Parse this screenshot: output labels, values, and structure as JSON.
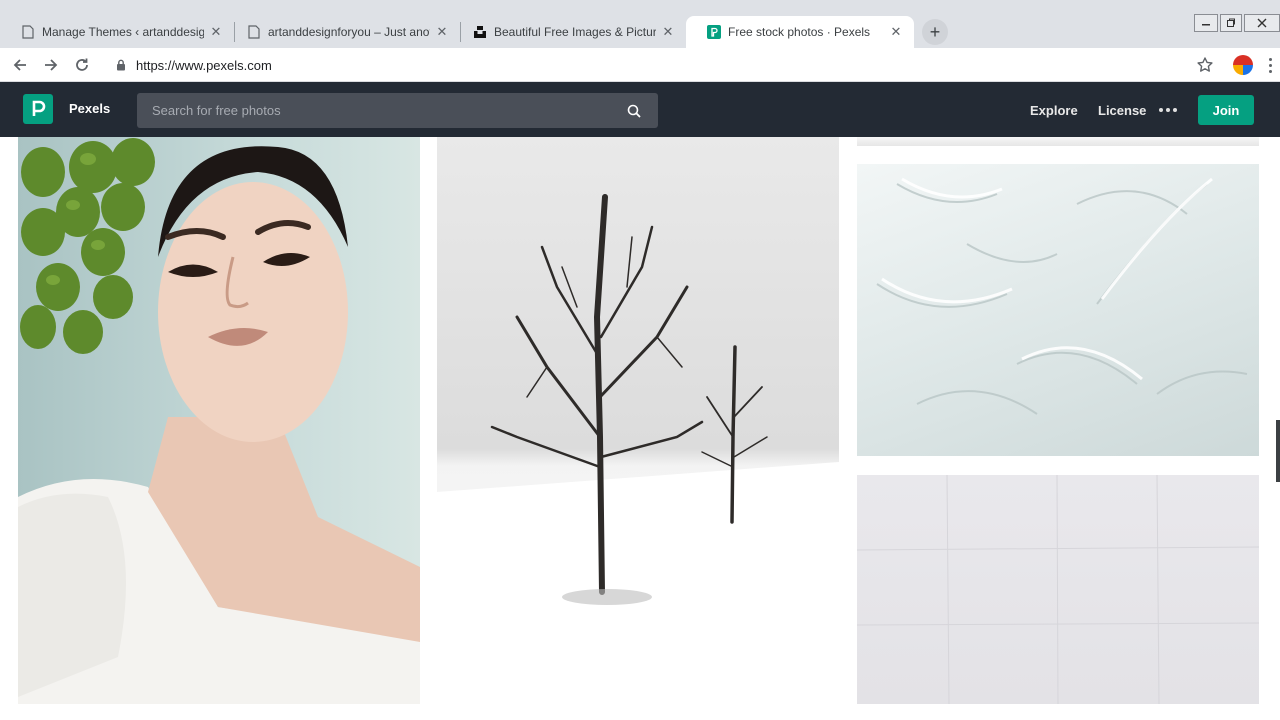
{
  "browser": {
    "tabs": [
      {
        "title": "Manage Themes ‹ artanddesignfo",
        "icon": "document-icon",
        "active": false
      },
      {
        "title": "artanddesignforyou – Just anothe",
        "icon": "document-icon",
        "active": false
      },
      {
        "title": "Beautiful Free Images & Pictures",
        "icon": "unsplash-icon",
        "active": false
      },
      {
        "title": "Free stock photos · Pexels",
        "icon": "pexels-icon",
        "active": true
      }
    ],
    "new_tab_symbol": "+",
    "close_symbol": "✕",
    "window_controls": [
      "minimize",
      "restore",
      "close"
    ],
    "url": "https://www.pexels.com"
  },
  "site": {
    "brand": "Pexels",
    "brand_color": "#05a081",
    "header_bg": "#232a34",
    "search_placeholder": "Search for free photos",
    "nav": {
      "explore": "Explore",
      "license": "License",
      "more": "more-icon",
      "join": "Join"
    }
  },
  "gallery": {
    "photos": [
      {
        "subject": "woman-with-grapes",
        "column": 1
      },
      {
        "subject": "bare-trees-in-snow",
        "column": 2
      },
      {
        "subject": "photo-partial",
        "column": 3
      },
      {
        "subject": "white-plaster-texture",
        "column": 3
      },
      {
        "subject": "white-wall-texture",
        "column": 3
      }
    ]
  }
}
